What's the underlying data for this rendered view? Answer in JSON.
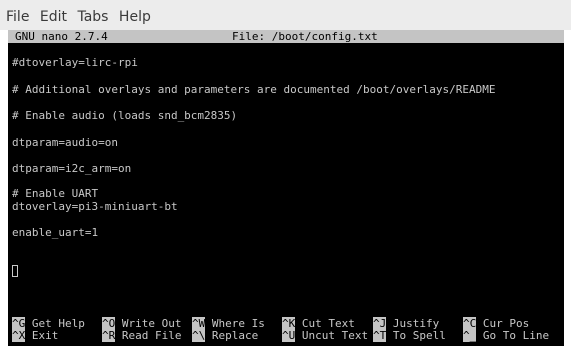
{
  "menu": [
    "File",
    "Edit",
    "Tabs",
    "Help"
  ],
  "nano": {
    "version": "GNU nano 2.7.4",
    "file": "File: /boot/config.txt"
  },
  "lines": [
    "#dtoverlay=lirc-rpi",
    "# Additional overlays and parameters are documented /boot/overlays/README",
    "# Enable audio (loads snd_bcm2835)",
    "dtparam=audio=on",
    "dtparam=i2c_arm=on",
    "# Enable UART",
    "dtoverlay=pi3-miniuart-bt",
    "enable_uart=1"
  ],
  "shortcuts": [
    {
      "key": "^G",
      "label": "Get Help"
    },
    {
      "key": "^O",
      "label": "Write Out"
    },
    {
      "key": "^W",
      "label": "Where Is"
    },
    {
      "key": "^K",
      "label": "Cut Text"
    },
    {
      "key": "^J",
      "label": "Justify"
    },
    {
      "key": "^C",
      "label": "Cur Pos"
    },
    {
      "key": "^X",
      "label": "Exit"
    },
    {
      "key": "^R",
      "label": "Read File"
    },
    {
      "key": "^\\",
      "label": "Replace"
    },
    {
      "key": "^U",
      "label": "Uncut Text"
    },
    {
      "key": "^T",
      "label": "To Spell"
    },
    {
      "key": "^_",
      "label": "Go To Line"
    }
  ]
}
